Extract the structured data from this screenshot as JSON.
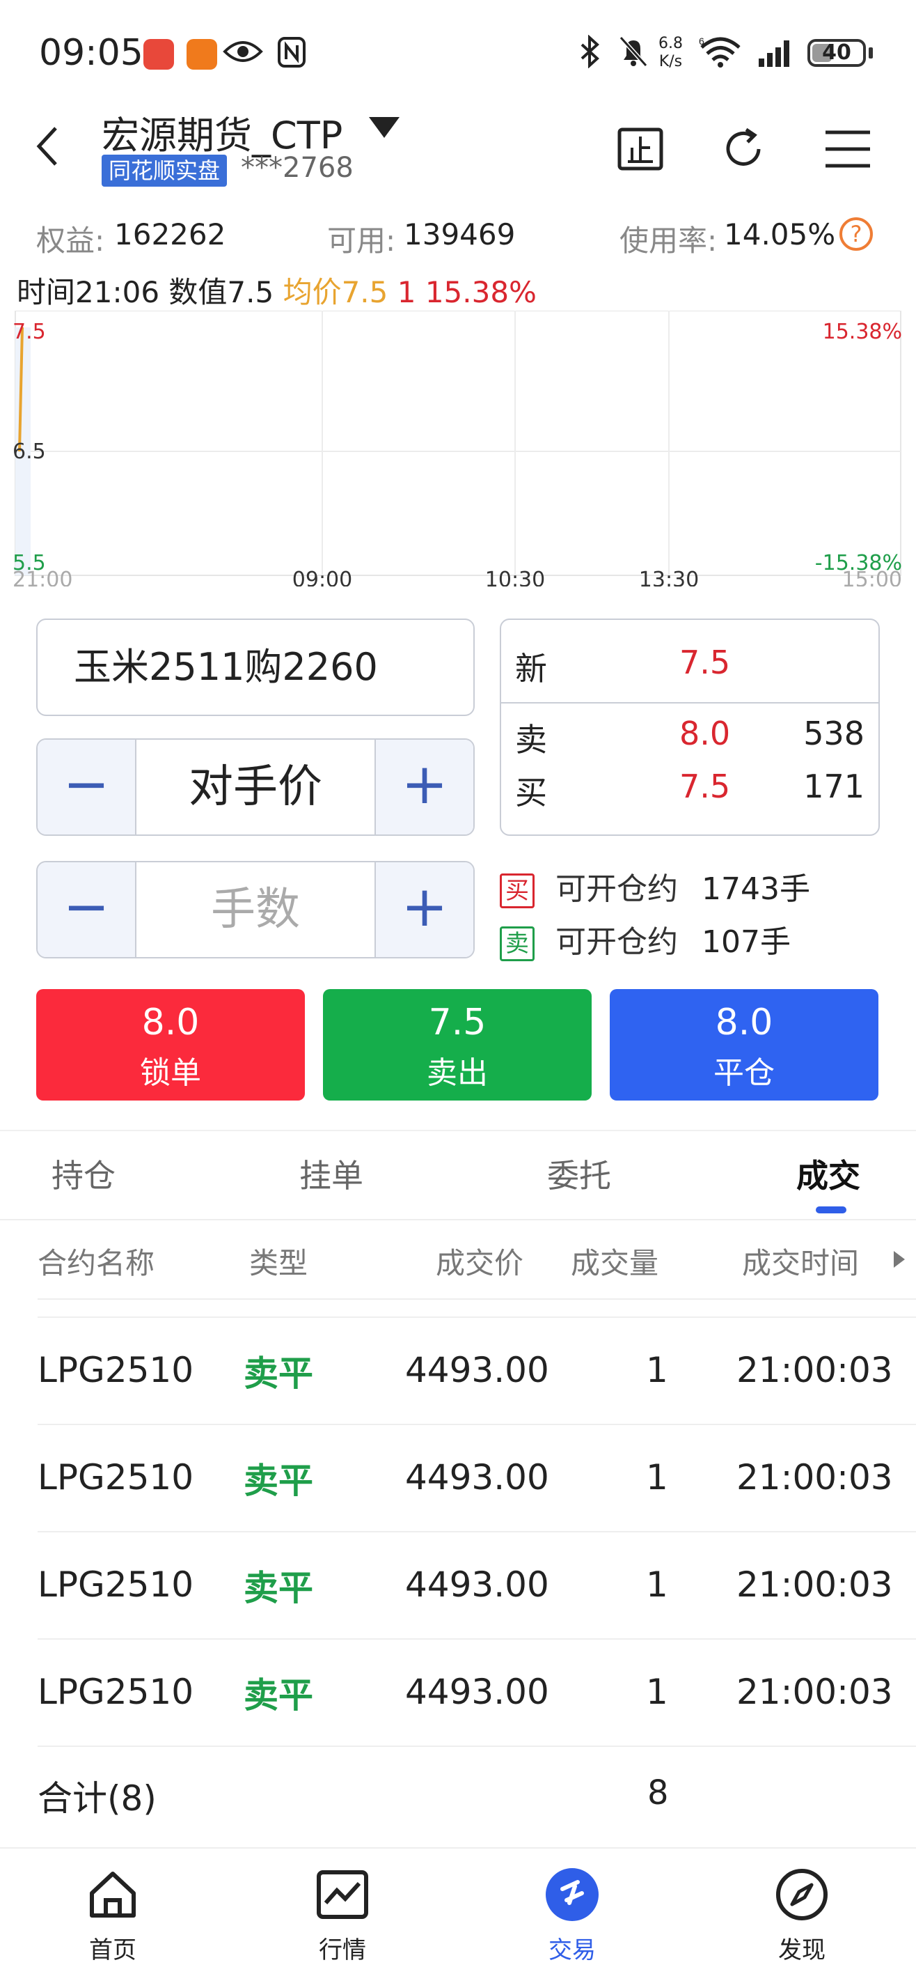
{
  "status_bar": {
    "time": "09:05",
    "network_speed_value": "6.8",
    "network_speed_unit": "K/s",
    "network_type": "6",
    "battery": "40"
  },
  "header": {
    "account_name": "宏源期货_CTP",
    "tag": "同花顺实盘",
    "account_number": "***2768"
  },
  "equity": {
    "equity_label": "权益:",
    "equity_value": "162262",
    "available_label": "可用:",
    "available_value": "139469",
    "usage_label": "使用率:",
    "usage_value": "14.05%",
    "help": "?"
  },
  "chart_info": {
    "time": "时间21:06",
    "value": "数值7.5",
    "avg": "均价7.5",
    "volume": "1",
    "change": "15.38%"
  },
  "chart_data": {
    "type": "line",
    "y_labels": [
      "7.5",
      "6.5",
      "5.5"
    ],
    "pct_labels": [
      "15.38%",
      "-15.38%"
    ],
    "x_labels": [
      "21:00",
      "09:00",
      "10:30",
      "13:30",
      "15:00"
    ],
    "ylim": [
      5.5,
      7.5
    ],
    "series": [
      {
        "values": [
          6.5,
          7.5
        ]
      }
    ]
  },
  "order": {
    "contract": "玉米2511购2260",
    "price_mode": "对手价",
    "quantity_placeholder": "手数",
    "minus": "−",
    "plus": "+"
  },
  "quote": {
    "new_label": "新",
    "new_price": "7.5",
    "sell_label": "卖",
    "sell_price": "8.0",
    "sell_volume": "538",
    "buy_label": "买",
    "buy_price": "7.5",
    "buy_volume": "171"
  },
  "open_capacity": {
    "buy_tag": "买",
    "sell_tag": "卖",
    "label": "可开仓约",
    "buy_amount": "1743手",
    "sell_amount": "107手"
  },
  "actions": [
    {
      "price": "8.0",
      "label": "锁单",
      "color": "#fb2a3c"
    },
    {
      "price": "7.5",
      "label": "卖出",
      "color": "#15ae4b"
    },
    {
      "price": "8.0",
      "label": "平仓",
      "color": "#2f63f1"
    }
  ],
  "tabs": [
    "持仓",
    "挂单",
    "委托",
    "成交"
  ],
  "table": {
    "headers": [
      "合约名称",
      "类型",
      "成交价",
      "成交量",
      "成交时间"
    ],
    "rows": [
      {
        "name": "LPG2510",
        "type": "卖平",
        "price": "4493.00",
        "qty": "1",
        "time": "21:00:03"
      },
      {
        "name": "LPG2510",
        "type": "卖平",
        "price": "4493.00",
        "qty": "1",
        "time": "21:00:03"
      },
      {
        "name": "LPG2510",
        "type": "卖平",
        "price": "4493.00",
        "qty": "1",
        "time": "21:00:03"
      },
      {
        "name": "LPG2510",
        "type": "卖平",
        "price": "4493.00",
        "qty": "1",
        "time": "21:00:03"
      }
    ],
    "total_label": "合计(8)",
    "total_qty": "8"
  },
  "nav": [
    {
      "label": "首页",
      "icon": "home-icon"
    },
    {
      "label": "行情",
      "icon": "chart-icon"
    },
    {
      "label": "交易",
      "icon": "trade-icon"
    },
    {
      "label": "发现",
      "icon": "compass-icon"
    }
  ],
  "colors": {
    "red": "#d9262f",
    "green": "#1f9e4a",
    "blue": "#2f5ee8",
    "gold": "#e8a430"
  }
}
